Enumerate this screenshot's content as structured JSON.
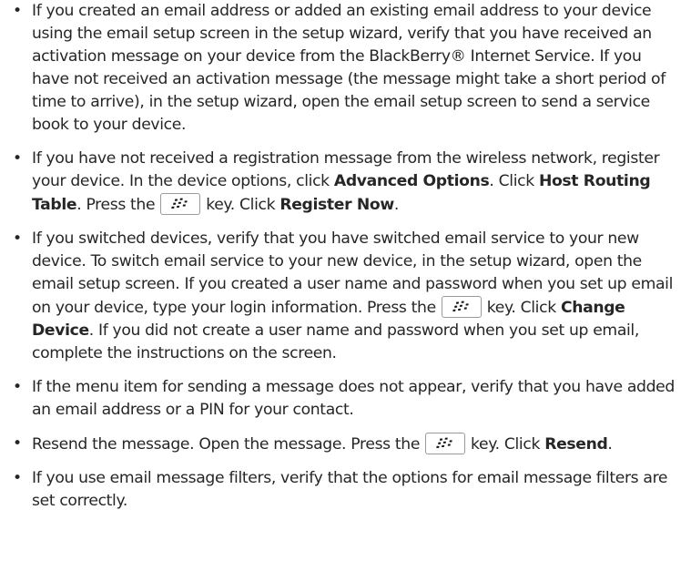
{
  "items": [
    {
      "t0": "If you created an email address or added an existing email address to your device using the email setup screen in the setup wizard, verify that you have received an activation message on your device from the BlackBerry® Internet Service. If you have not received an activation message (the message might take a short period of time to arrive), in the setup wizard, open the email setup screen to send a service book to your device."
    },
    {
      "t0": "If you have not received a registration message from the wireless network, register your device. In the device options, click ",
      "b0": "Advanced Options",
      "t1": ". Click ",
      "b1": "Host Routing Table",
      "t2": ". Press the",
      "t3": "key. Click ",
      "b2": "Register Now",
      "t4": "."
    },
    {
      "t0": "If you switched devices, verify that you have switched email service to your new device. To switch email service to your new device, in the setup wizard, open the email setup screen. If you created a user name and password when you set up email on your device, type your login information. Press the",
      "t1": "key. Click ",
      "b0": "Change Device",
      "t2": ". If you did not create a user name and password when you set up email, complete the instructions on the screen."
    },
    {
      "t0": "If the menu item for sending a message does not appear, verify that you have added an email address or a PIN for your contact."
    },
    {
      "t0": "Resend the message. Open the message. Press the",
      "t1": "key. Click ",
      "b0": "Resend",
      "t2": "."
    },
    {
      "t0": "If you use email message filters, verify that the options for email message filters are set correctly."
    }
  ],
  "icons": {
    "menu_key": "blackberry-menu-key-icon"
  }
}
